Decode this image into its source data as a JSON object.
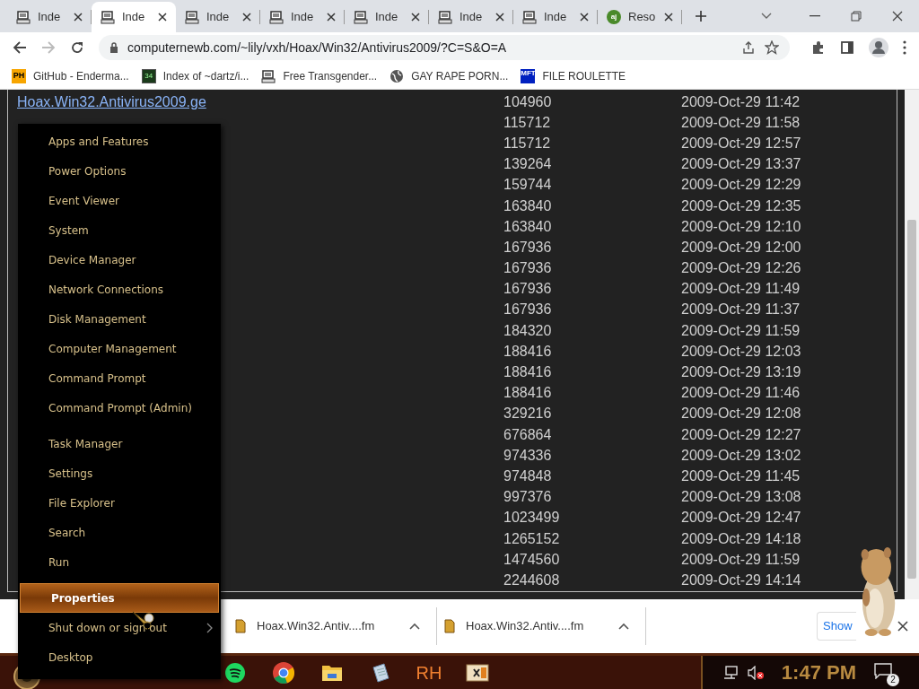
{
  "tabs": [
    {
      "title": "Inde",
      "kind": "computer",
      "selected": false
    },
    {
      "title": "Inde",
      "kind": "computer",
      "selected": true
    },
    {
      "title": "Inde",
      "kind": "computer",
      "selected": false
    },
    {
      "title": "Inde",
      "kind": "computer",
      "selected": false
    },
    {
      "title": "Inde",
      "kind": "computer",
      "selected": false
    },
    {
      "title": "Inde",
      "kind": "computer",
      "selected": false
    },
    {
      "title": "Inde",
      "kind": "computer",
      "selected": false
    },
    {
      "title": "Reso",
      "kind": "badge",
      "badge": "aj",
      "selected": false
    }
  ],
  "address_bar": {
    "url": "computernewb.com/~lily/vxh/Hoax/Win32/Antivirus2009/?C=S&O=A"
  },
  "bookmarks": [
    {
      "label": "GitHub - Enderma...",
      "kind": "text",
      "icon_text": "PH"
    },
    {
      "label": "Index of ~dartz/i...",
      "kind": "grid",
      "icon_text": "34"
    },
    {
      "label": "Free Transgender...",
      "kind": "computer"
    },
    {
      "label": "GAY RAPE PORN...",
      "kind": "globe"
    },
    {
      "label": "FILE ROULETTE",
      "kind": "mft",
      "icon_text": "MFT"
    }
  ],
  "listing": {
    "rows": [
      {
        "name": "Hoax.Win32.Antivirus2009.ge",
        "size": "104960",
        "modified": "2009-Oct-29 11:42"
      },
      {
        "size": "115712",
        "modified": "2009-Oct-29 11:58"
      },
      {
        "size": "115712",
        "modified": "2009-Oct-29 12:57"
      },
      {
        "size": "139264",
        "modified": "2009-Oct-29 13:37"
      },
      {
        "size": "159744",
        "modified": "2009-Oct-29 12:29"
      },
      {
        "size": "163840",
        "modified": "2009-Oct-29 12:35"
      },
      {
        "size": "163840",
        "modified": "2009-Oct-29 12:10"
      },
      {
        "size": "167936",
        "modified": "2009-Oct-29 12:00"
      },
      {
        "size": "167936",
        "modified": "2009-Oct-29 12:26"
      },
      {
        "size": "167936",
        "modified": "2009-Oct-29 11:49"
      },
      {
        "size": "167936",
        "modified": "2009-Oct-29 11:37"
      },
      {
        "size": "184320",
        "modified": "2009-Oct-29 11:59"
      },
      {
        "size": "188416",
        "modified": "2009-Oct-29 12:03"
      },
      {
        "size": "188416",
        "modified": "2009-Oct-29 13:19"
      },
      {
        "size": "188416",
        "modified": "2009-Oct-29 11:46"
      },
      {
        "size": "329216",
        "modified": "2009-Oct-29 12:08"
      },
      {
        "size": "676864",
        "modified": "2009-Oct-29 12:27"
      },
      {
        "size": "974336",
        "modified": "2009-Oct-29 13:02"
      },
      {
        "size": "974848",
        "modified": "2009-Oct-29 11:45"
      },
      {
        "size": "997376",
        "modified": "2009-Oct-29 13:08"
      },
      {
        "size": "1023499",
        "modified": "2009-Oct-29 12:47"
      },
      {
        "size": "1265152",
        "modified": "2009-Oct-29 14:18"
      },
      {
        "size": "1474560",
        "modified": "2009-Oct-29 11:59"
      },
      {
        "size": "2244608",
        "modified": "2009-Oct-29 14:14"
      }
    ]
  },
  "context_menu": {
    "groups": [
      [
        {
          "label": "Apps and Features",
          "kind": "item",
          "selected": false
        },
        {
          "label": "Power Options",
          "kind": "item",
          "selected": false
        },
        {
          "label": "Event Viewer",
          "kind": "item",
          "selected": false
        },
        {
          "label": "System",
          "kind": "item",
          "selected": false
        },
        {
          "label": "Device Manager",
          "kind": "item",
          "selected": false
        },
        {
          "label": "Network Connections",
          "kind": "item",
          "selected": false
        },
        {
          "label": "Disk Management",
          "kind": "item",
          "selected": false
        },
        {
          "label": "Computer Management",
          "kind": "item",
          "selected": false
        },
        {
          "label": "Command Prompt",
          "kind": "item",
          "selected": false
        },
        {
          "label": "Command Prompt (Admin)",
          "kind": "item",
          "selected": false
        }
      ],
      [
        {
          "label": "Task Manager",
          "kind": "item",
          "selected": false
        },
        {
          "label": "Settings",
          "kind": "item",
          "selected": false
        },
        {
          "label": "File Explorer",
          "kind": "item",
          "selected": false
        },
        {
          "label": "Search",
          "kind": "item",
          "selected": false
        },
        {
          "label": "Run",
          "kind": "item",
          "selected": false
        }
      ],
      [
        {
          "label": "Properties",
          "kind": "item",
          "selected": true
        },
        {
          "label": "Shut down or sign out",
          "kind": "submenu",
          "selected": false
        },
        {
          "label": "Desktop",
          "kind": "item",
          "selected": false
        }
      ]
    ]
  },
  "downloads": {
    "items": [
      {
        "name": "Hoax.Win32.Antiv....fm"
      },
      {
        "name": "Hoax.Win32.Antiv....fm"
      }
    ],
    "show_all": "Show"
  },
  "taskbar": {
    "apps": [
      {
        "kind": "music"
      },
      {
        "kind": "browser"
      },
      {
        "kind": "folder"
      },
      {
        "kind": "notepad"
      },
      {
        "kind": "text",
        "label": "RH"
      },
      {
        "kind": "hex"
      }
    ],
    "clock": "1:47 PM",
    "notifications": "2"
  }
}
